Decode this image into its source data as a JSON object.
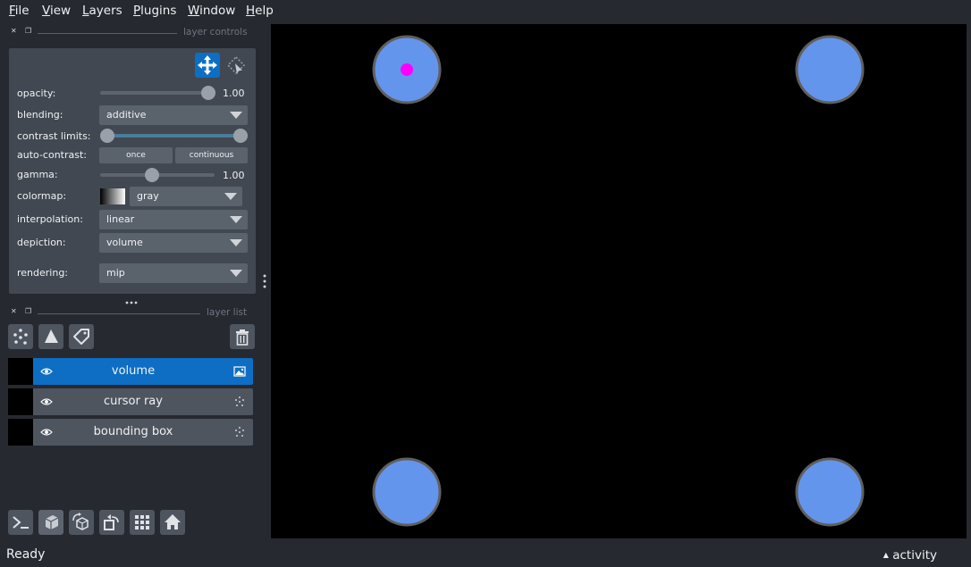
{
  "menu": [
    "File",
    "View",
    "Layers",
    "Plugins",
    "Window",
    "Help"
  ],
  "layer_controls": {
    "title": "layer controls",
    "opacity": {
      "label": "opacity:",
      "value": "1.00",
      "fraction": 1.0
    },
    "blending": {
      "label": "blending:",
      "value": "additive"
    },
    "contrast_limits": {
      "label": "contrast limits:",
      "low_fraction": 0.0,
      "high_fraction": 1.0
    },
    "auto_contrast": {
      "label": "auto-contrast:",
      "once": "once",
      "continuous": "continuous"
    },
    "gamma": {
      "label": "gamma:",
      "value": "1.00",
      "fraction": 0.45
    },
    "colormap": {
      "label": "colormap:",
      "value": "gray"
    },
    "interpolation": {
      "label": "interpolation:",
      "value": "linear"
    },
    "depiction": {
      "label": "depiction:",
      "value": "volume"
    },
    "rendering": {
      "label": "rendering:",
      "value": "mip"
    }
  },
  "layer_list": {
    "title": "layer list",
    "layers": [
      {
        "name": "volume",
        "type_icon": "image-icon",
        "selected": true
      },
      {
        "name": "cursor ray",
        "type_icon": "points-icon",
        "selected": false
      },
      {
        "name": "bounding box",
        "type_icon": "points-icon",
        "selected": false
      }
    ]
  },
  "status": {
    "text": "Ready",
    "activity": "activity"
  },
  "colors": {
    "accent": "#0e6ec3",
    "point_fill": "#6495ed",
    "cursor_point": "#ff00ff"
  }
}
